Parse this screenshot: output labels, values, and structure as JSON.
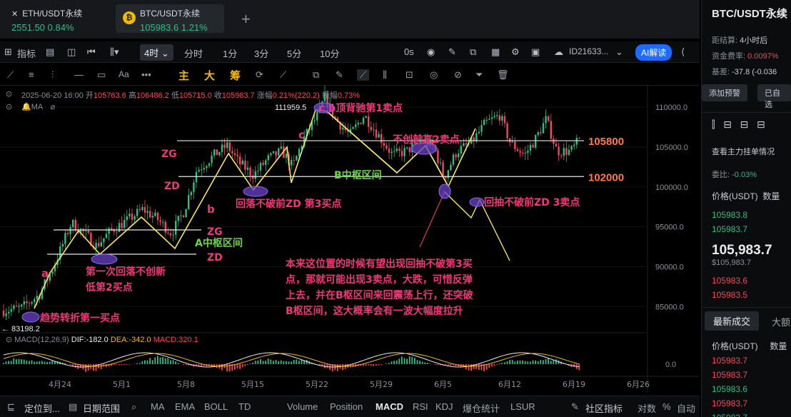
{
  "tabs": [
    {
      "name": "ETH/USDT永续",
      "price": "2551.50",
      "change": "0.84%"
    },
    {
      "name": "BTC/USDT永续",
      "price": "105983.6",
      "change": "1.21%"
    }
  ],
  "toolbar1": {
    "indicator": "指标",
    "interval_active": "4时",
    "intervals": [
      "分时",
      "1分",
      "3分",
      "5分",
      "10分"
    ],
    "zero_s": "0s",
    "account_id": "ID21633...",
    "ai": "AI解读"
  },
  "toolbar2": {
    "zhu": "主",
    "da": "大",
    "chou": "筹"
  },
  "ohlc": {
    "date": "2025-06-20 16:00",
    "open_label": "开",
    "open": "105763.6",
    "high_label": "高",
    "high": "106486.2",
    "low_label": "低",
    "low": "105715.0",
    "close_label": "收",
    "close": "105983.7",
    "chg_label": "涨幅",
    "chg": "0.21%(220.2)",
    "amp_label": "振幅",
    "amp": "0.73%"
  },
  "ma_label": "MA",
  "macd": {
    "label": "MACD(12,26,9)",
    "dif": "DIF:-182.0",
    "dea": "DEA:-342.0",
    "macd": "MACD:320.1"
  },
  "chart_data": {
    "type": "candlestick",
    "y_ticks": [
      "110000.0",
      "105000.0",
      "100000.0",
      "95000.0",
      "90000.0",
      "85000.0"
    ],
    "y_tick_values": [
      110000,
      105000,
      100000,
      95000,
      90000,
      85000
    ],
    "ylim": [
      81800,
      112700
    ],
    "x_ticks": [
      "4月24",
      "5月1",
      "5月8",
      "5月15",
      "5月22",
      "5月29",
      "6月5",
      "6月12",
      "6月19",
      "6月26"
    ],
    "macd_tick": "0.0",
    "hlines": [
      {
        "label": "105800",
        "value": 105800
      },
      {
        "label": "102000",
        "value": 101300
      }
    ],
    "max_label": "111959.5",
    "min_label": "← 83198.2",
    "annotations": {
      "a": "a",
      "b": "b",
      "c": "c",
      "zg": "ZG",
      "zd": "ZD",
      "zg2": "ZG",
      "zd2": "ZD",
      "a_zone": "A中枢区间",
      "b_zone": "B中枢区间",
      "buy1": "趋势转折第一买点",
      "buy2_line1": "第一次回落不创新",
      "buy2_line2": "低第2买点",
      "buy3": "回落不破前ZD 第3买点",
      "sell1": "c b顶背驰第1卖点",
      "sell2": "不创前高2卖点",
      "sell3": "回抽不破前ZD 3卖点",
      "note1": "本来这位置的时候有望出现回抽不破第3买",
      "note2": "点，那就可能出现3卖点，大跌，可惜反弹",
      "note3": "上去，并在B枢区间来回震荡上行，还突破",
      "note4": "B枢区间，这大概率会有一波大幅度拉升"
    }
  },
  "right_panel": {
    "title": "BTC/USDT永续",
    "settle_label": "距结算:",
    "settle": "4小时后",
    "funding_label": "资金费率:",
    "funding": "0.0097%",
    "basis_label": "基差:",
    "basis": "-37.8 (-0.036",
    "alert_btn": "添加预警",
    "selected_btn": "已自选",
    "orderbook_link": "查看主力挂单情况",
    "ratio_label": "委比:",
    "ratio": "-0.03%",
    "price_header": "价格(USDT)",
    "qty_header": "数量",
    "asks": [
      "105983.8",
      "105983.7"
    ],
    "last": "105,983.7",
    "last_sub": "$105,983.7",
    "bids": [
      "105983.6",
      "105983.5"
    ],
    "trades_tab": "最新成交",
    "big_tab": "大额",
    "trades_header": "价格(USDT)",
    "trades_qty": "数量",
    "trades": [
      {
        "p": "105983.7",
        "c": "red"
      },
      {
        "p": "105983.7",
        "c": "red"
      },
      {
        "p": "105983.6",
        "c": "green"
      },
      {
        "p": "105983.7",
        "c": "red"
      },
      {
        "p": "105983.7",
        "c": "green"
      }
    ]
  },
  "bottombar": {
    "locate": "定位到...",
    "range": "日期范围",
    "indicators": [
      "MA",
      "EMA",
      "BOLL",
      "TD",
      "Volume",
      "Position",
      "MACD",
      "RSI",
      "KDJ",
      "爆仓统计",
      "LSUR"
    ],
    "community": "社区指标",
    "items": [
      "对数",
      "%",
      "自动"
    ]
  }
}
